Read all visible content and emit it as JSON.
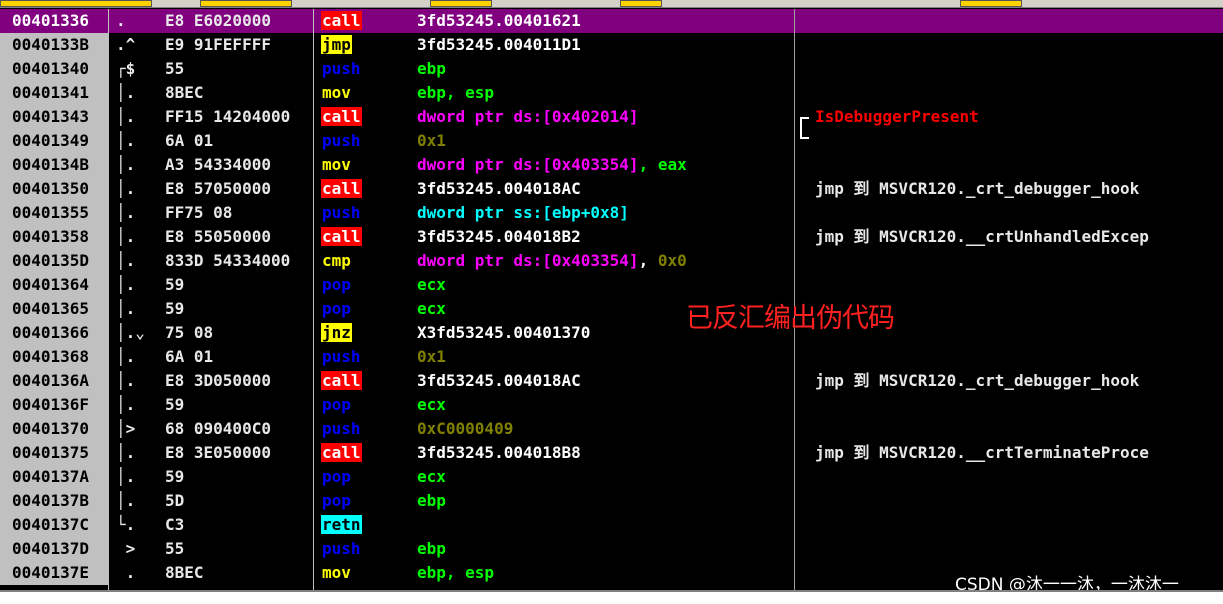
{
  "colors": {
    "call_bg": "#ff0000",
    "call_fg": "#ffffff",
    "jmp_bg": "#ffff00",
    "jmp_fg": "#000000",
    "jnz_bg": "#ffff00",
    "jnz_fg": "#000000",
    "push_fg": "#0000ff",
    "pop_fg": "#0000ff",
    "mov_fg": "#ffff00",
    "cmp_fg": "#ffff00",
    "retn_bg": "#00ffff",
    "retn_fg": "#000000",
    "reg_fg": "#00ff00",
    "mem_fg": "#ff00ff",
    "imm_fg": "#808000",
    "addr_fg": "#ffffff",
    "stack_fg": "#00ffff",
    "api_fg": "#ff0000",
    "selected_row": "#800080"
  },
  "rows": [
    {
      "addr": "00401336",
      "mark": ".",
      "hex": "E8 E6020000",
      "mn": "call",
      "ops": [
        {
          "t": "3fd53245.00401621",
          "k": "addr"
        }
      ],
      "comment": "",
      "selected": true
    },
    {
      "addr": "0040133B",
      "mark": ".^",
      "hex": "E9 91FEFFFF",
      "mn": "jmp",
      "ops": [
        {
          "t": "3fd53245.004011D1",
          "k": "addr"
        }
      ],
      "comment": ""
    },
    {
      "addr": "00401340",
      "mark": "┌$",
      "hex": "55",
      "mn": "push",
      "ops": [
        {
          "t": "ebp",
          "k": "reg"
        }
      ],
      "comment": ""
    },
    {
      "addr": "00401341",
      "mark": "│.",
      "hex": "8BEC",
      "mn": "mov",
      "ops": [
        {
          "t": "ebp, esp",
          "k": "reg"
        }
      ],
      "comment": ""
    },
    {
      "addr": "00401343",
      "mark": "│.",
      "hex": "FF15 14204000",
      "mn": "call",
      "ops": [
        {
          "t": "dword ptr ds:[0x402014]",
          "k": "mem"
        }
      ],
      "comment": "IsDebuggerPresent",
      "comment_kind": "api"
    },
    {
      "addr": "00401349",
      "mark": "│.",
      "hex": "6A 01",
      "mn": "push",
      "ops": [
        {
          "t": "0x1",
          "k": "imm"
        }
      ],
      "comment": ""
    },
    {
      "addr": "0040134B",
      "mark": "│.",
      "hex": "A3 54334000",
      "mn": "mov",
      "ops": [
        {
          "t": "dword ptr ds:[0x403354]",
          "k": "mem"
        },
        {
          "t": ", eax",
          "k": "reg"
        }
      ],
      "comment": ""
    },
    {
      "addr": "00401350",
      "mark": "│.",
      "hex": "E8 57050000",
      "mn": "call",
      "ops": [
        {
          "t": "3fd53245.004018AC",
          "k": "addr"
        }
      ],
      "comment": "jmp 到 MSVCR120._crt_debugger_hook"
    },
    {
      "addr": "00401355",
      "mark": "│.",
      "hex": "FF75 08",
      "mn": "push",
      "ops": [
        {
          "t": "dword ptr ss:[ebp+0x8]",
          "k": "stack"
        }
      ],
      "comment": ""
    },
    {
      "addr": "00401358",
      "mark": "│.",
      "hex": "E8 55050000",
      "mn": "call",
      "ops": [
        {
          "t": "3fd53245.004018B2",
          "k": "addr"
        }
      ],
      "comment": "jmp 到 MSVCR120.__crtUnhandledExcep"
    },
    {
      "addr": "0040135D",
      "mark": "│.",
      "hex": "833D 54334000",
      "mn": "cmp",
      "ops": [
        {
          "t": "dword ptr ds:[0x403354]",
          "k": "mem"
        },
        {
          "t": ", ",
          "k": "plain"
        },
        {
          "t": "0x0",
          "k": "imm"
        }
      ],
      "comment": ""
    },
    {
      "addr": "00401364",
      "mark": "│.",
      "hex": "59",
      "mn": "pop",
      "ops": [
        {
          "t": "ecx",
          "k": "reg"
        }
      ],
      "comment": ""
    },
    {
      "addr": "00401365",
      "mark": "│.",
      "hex": "59",
      "mn": "pop",
      "ops": [
        {
          "t": "ecx",
          "k": "reg"
        }
      ],
      "comment": ""
    },
    {
      "addr": "00401366",
      "mark": "│.⌄",
      "hex": "75 08",
      "mn": "jnz",
      "ops": [
        {
          "t": "X3fd53245.00401370",
          "k": "addr"
        }
      ],
      "comment": ""
    },
    {
      "addr": "00401368",
      "mark": "│.",
      "hex": "6A 01",
      "mn": "push",
      "ops": [
        {
          "t": "0x1",
          "k": "imm"
        }
      ],
      "comment": ""
    },
    {
      "addr": "0040136A",
      "mark": "│.",
      "hex": "E8 3D050000",
      "mn": "call",
      "ops": [
        {
          "t": "3fd53245.004018AC",
          "k": "addr"
        }
      ],
      "comment": "jmp 到 MSVCR120._crt_debugger_hook"
    },
    {
      "addr": "0040136F",
      "mark": "│.",
      "hex": "59",
      "mn": "pop",
      "ops": [
        {
          "t": "ecx",
          "k": "reg"
        }
      ],
      "comment": ""
    },
    {
      "addr": "00401370",
      "mark": "│>",
      "hex": "68 090400C0",
      "mn": "push",
      "ops": [
        {
          "t": "0xC0000409",
          "k": "imm"
        }
      ],
      "comment": ""
    },
    {
      "addr": "00401375",
      "mark": "│.",
      "hex": "E8 3E050000",
      "mn": "call",
      "ops": [
        {
          "t": "3fd53245.004018B8",
          "k": "addr"
        }
      ],
      "comment": "jmp 到 MSVCR120.__crtTerminateProce"
    },
    {
      "addr": "0040137A",
      "mark": "│.",
      "hex": "59",
      "mn": "pop",
      "ops": [
        {
          "t": "ecx",
          "k": "reg"
        }
      ],
      "comment": ""
    },
    {
      "addr": "0040137B",
      "mark": "│.",
      "hex": "5D",
      "mn": "pop",
      "ops": [
        {
          "t": "ebp",
          "k": "reg"
        }
      ],
      "comment": ""
    },
    {
      "addr": "0040137C",
      "mark": "└.",
      "hex": "C3",
      "mn": "retn",
      "ops": [],
      "comment": ""
    },
    {
      "addr": "0040137D",
      "mark": " >",
      "hex": "55",
      "mn": "push",
      "ops": [
        {
          "t": "ebp",
          "k": "reg"
        }
      ],
      "comment": ""
    },
    {
      "addr": "0040137E",
      "mark": " .",
      "hex": "8BEC",
      "mn": "mov",
      "ops": [
        {
          "t": "ebp, esp",
          "k": "reg"
        }
      ],
      "comment": ""
    }
  ],
  "overlay_text": "已反汇编出伪代码",
  "watermark": "CSDN @沐一一沐，一沐沐一"
}
